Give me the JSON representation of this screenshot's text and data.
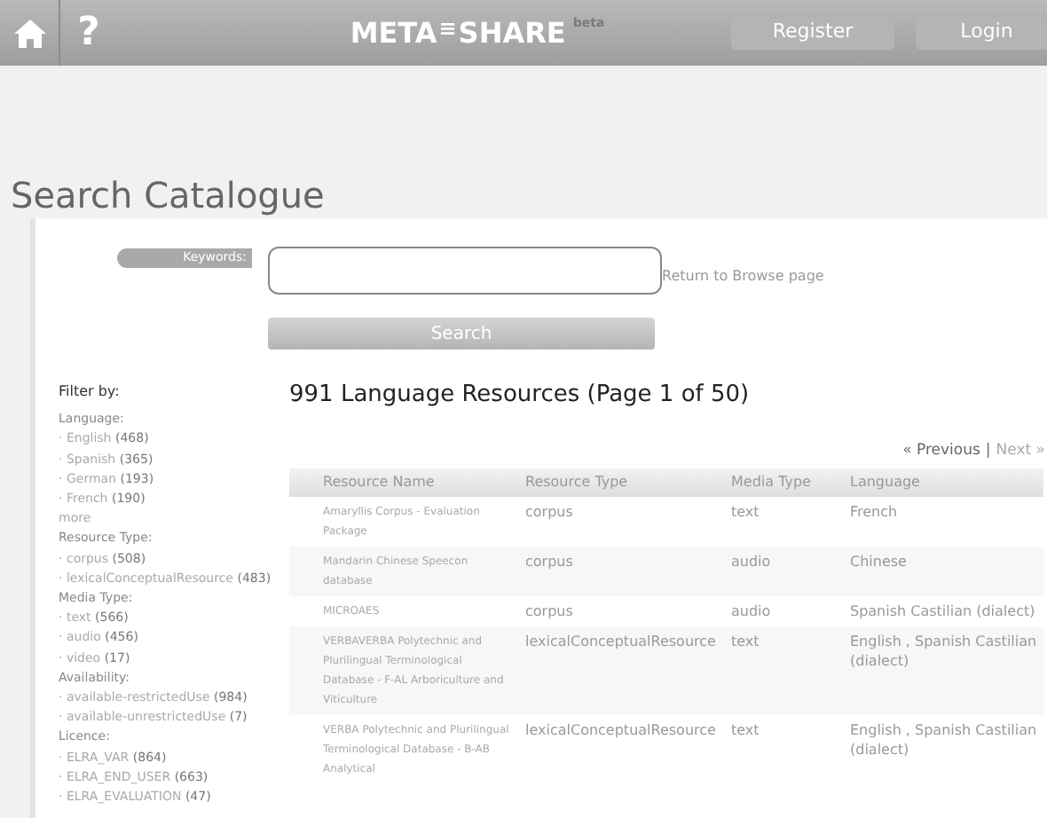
{
  "nav": {
    "help": "?",
    "logo_left": "META",
    "logo_mark": "≡",
    "logo_right": "SHARE",
    "logo_sup": "beta",
    "buttons": [
      "Register",
      "Login"
    ]
  },
  "page_title": "Search Catalogue",
  "search": {
    "label": "Keywords:",
    "return_link": "Return to Browse page",
    "button": "Search"
  },
  "filter": {
    "title": "Filter by:",
    "bullet": "·",
    "groups": [
      {
        "heading": "Language:",
        "items": [
          {
            "label": "English",
            "count": "(468)"
          },
          {
            "label": "Spanish",
            "count": "(365)"
          },
          {
            "label": "German",
            "count": "(193)"
          },
          {
            "label": "French",
            "count": "(190)"
          }
        ],
        "more": "more"
      },
      {
        "heading": "Resource Type:",
        "items": [
          {
            "label": "corpus",
            "count": "(508)"
          },
          {
            "label": "lexicalConceptualResource",
            "count": "(483)"
          }
        ]
      },
      {
        "heading": "Media Type:",
        "items": [
          {
            "label": "text",
            "count": "(566)"
          },
          {
            "label": "audio",
            "count": "(456)"
          },
          {
            "label": "video",
            "count": "(17)"
          }
        ]
      },
      {
        "heading": "Availability:",
        "items": [
          {
            "label": "available-restrictedUse",
            "count": "(984)"
          },
          {
            "label": "available-unrestrictedUse",
            "count": "(7)"
          }
        ]
      },
      {
        "heading": "Licence:",
        "items": [
          {
            "label": "ELRA_VAR",
            "count": "(864)"
          },
          {
            "label": "ELRA_END_USER",
            "count": "(663)"
          },
          {
            "label": "ELRA_EVALUATION",
            "count": "(47)"
          }
        ]
      }
    ]
  },
  "results": {
    "title": "991 Language Resources (Page 1 of 50)",
    "previous": "« Previous",
    "separator": "|",
    "next": "Next »",
    "next_disabled": true,
    "columns": [
      "Resource Name",
      "Resource Type",
      "Media Type",
      "Language"
    ],
    "rows": [
      [
        "Amaryllis Corpus - Evaluation Package",
        "corpus",
        "text",
        "French"
      ],
      [
        "Mandarin Chinese Speecon database",
        "corpus",
        "audio",
        "Chinese"
      ],
      [
        "MICROAES",
        "corpus",
        "audio",
        "Spanish Castilian (dialect)"
      ],
      [
        "VERBAVERBA Polytechnic and Plurilingual Terminological Database - F-AL Arboriculture and Viticulture",
        "lexicalConceptualResource",
        "text",
        "English , Spanish Castilian (dialect)"
      ],
      [
        "VERBA Polytechnic and Plurilingual Terminological Database - B-AB Analytical",
        "lexicalConceptualResource",
        "text",
        "English , Spanish Castilian (dialect)"
      ]
    ]
  }
}
